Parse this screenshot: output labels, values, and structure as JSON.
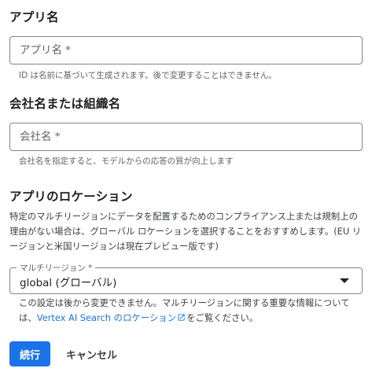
{
  "app_name_section": {
    "title": "アプリ名",
    "input_placeholder": "アプリ名 *",
    "input_value": "",
    "hint": "ID は名前に基づいて生成されます。後で変更することはできません。"
  },
  "company_section": {
    "title": "会社名または組織名",
    "input_placeholder": "会社名 *",
    "input_value": "",
    "hint": "会社名を指定すると、モデルからの応答の質が向上します"
  },
  "location_section": {
    "title": "アプリのロケーション",
    "description": "特定のマルチリージョンにデータを配置するためのコンプライアンス上または規制上の理由がない場合は、グローバル ロケーションを選択することをおすすめします。(EU リージョンと米国リージョンは現在プレビュー版です)",
    "select_label": "マルチリージョン *",
    "select_value": "global (グローバル)",
    "note_prefix": "この設定は後から変更できません。マルチリージョンに関する重要な情報については、",
    "note_link": "Vertex AI Search のロケーション",
    "note_suffix": "をご覧ください。"
  },
  "actions": {
    "continue_label": "続行",
    "cancel_label": "キャンセル"
  },
  "colors": {
    "primary": "#1a73e8",
    "text": "#202124",
    "hint": "#5f6368",
    "border": "#80868b"
  },
  "icons": {
    "external_link": "open-in-new-icon",
    "dropdown": "caret-down-icon"
  }
}
